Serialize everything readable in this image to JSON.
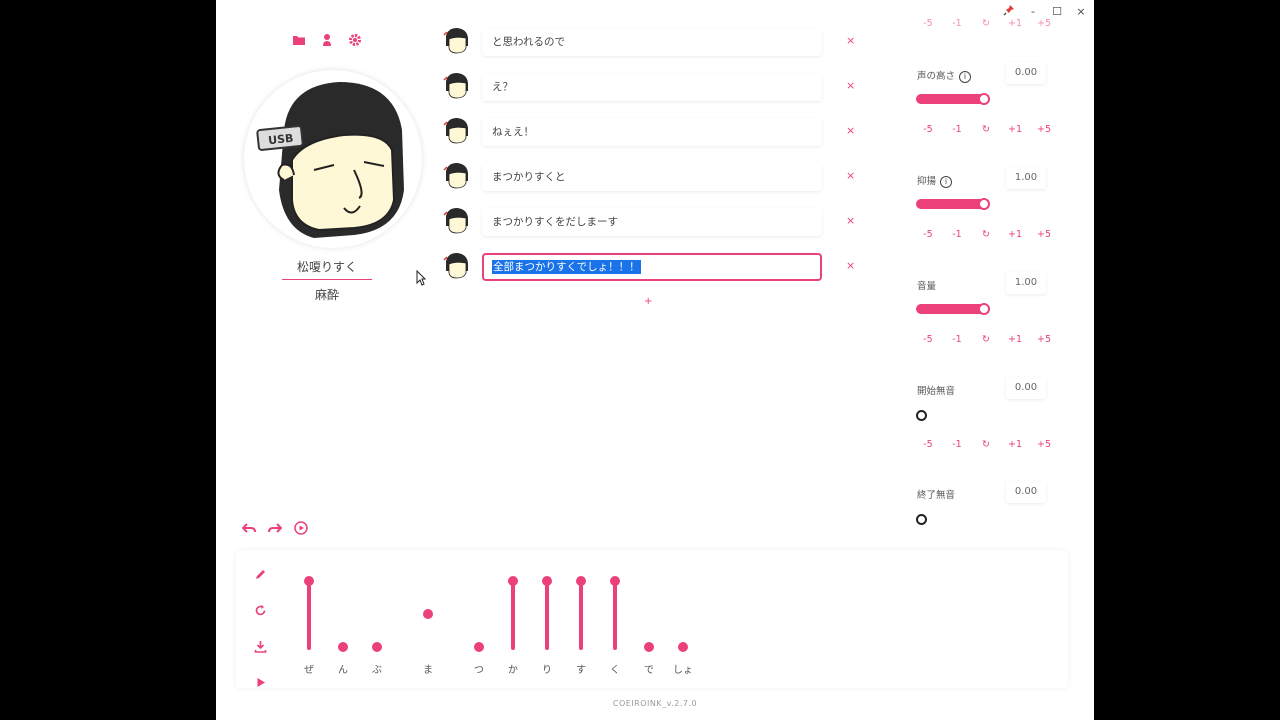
{
  "window": {
    "pin_icon": "pin-icon",
    "minimize": "-",
    "maximize": "☐",
    "close": "×"
  },
  "top_icons": [
    "folder-icon",
    "person-icon",
    "gear-icon"
  ],
  "character": {
    "name": "松嗄りすく",
    "style": "麻酔"
  },
  "lines": [
    {
      "text": "と思われるので",
      "active": false
    },
    {
      "text": "え？",
      "active": false
    },
    {
      "text": "ねぇえ！",
      "active": false
    },
    {
      "text": "まつかりすくと",
      "active": false
    },
    {
      "text": "まつかりすくをだしまーす",
      "active": false
    },
    {
      "text": "全部まつかりすくでしょ！！！",
      "active": true
    }
  ],
  "delete_label": "×",
  "add_label": "+",
  "params": [
    {
      "label": "声の高さ",
      "info": true,
      "value": "0.00",
      "level": 1.0
    },
    {
      "label": "抑揚",
      "info": true,
      "value": "1.00",
      "level": 1.0
    },
    {
      "label": "音量",
      "info": false,
      "value": "1.00",
      "level": 1.0
    },
    {
      "label": "開始無音",
      "info": false,
      "value": "0.00",
      "level": 0.0
    },
    {
      "label": "終了無音",
      "info": false,
      "value": "0.00",
      "level": 0.0
    }
  ],
  "step_buttons": [
    "-5",
    "-1",
    "↻",
    "+1",
    "+5"
  ],
  "top_partial_buttons": [
    "-5",
    "-1",
    "↻",
    "+1",
    "+5"
  ],
  "phonemes": [
    {
      "char": "ぜ",
      "level": 1.0
    },
    {
      "char": "ん",
      "level": 0.0
    },
    {
      "char": "ぶ",
      "level": 0.0
    },
    {
      "char": "ま",
      "level": 0.5
    },
    {
      "char": "つ",
      "level": 0.0
    },
    {
      "char": "か",
      "level": 1.0
    },
    {
      "char": "り",
      "level": 1.0
    },
    {
      "char": "す",
      "level": 1.0
    },
    {
      "char": "く",
      "level": 1.0
    },
    {
      "char": "で",
      "level": 0.0
    },
    {
      "char": "しょ",
      "level": 0.0
    }
  ],
  "version": "COEIROINK_v.2.7.0",
  "colors": {
    "accent": "#ec407a",
    "selection": "#1a73e8"
  }
}
